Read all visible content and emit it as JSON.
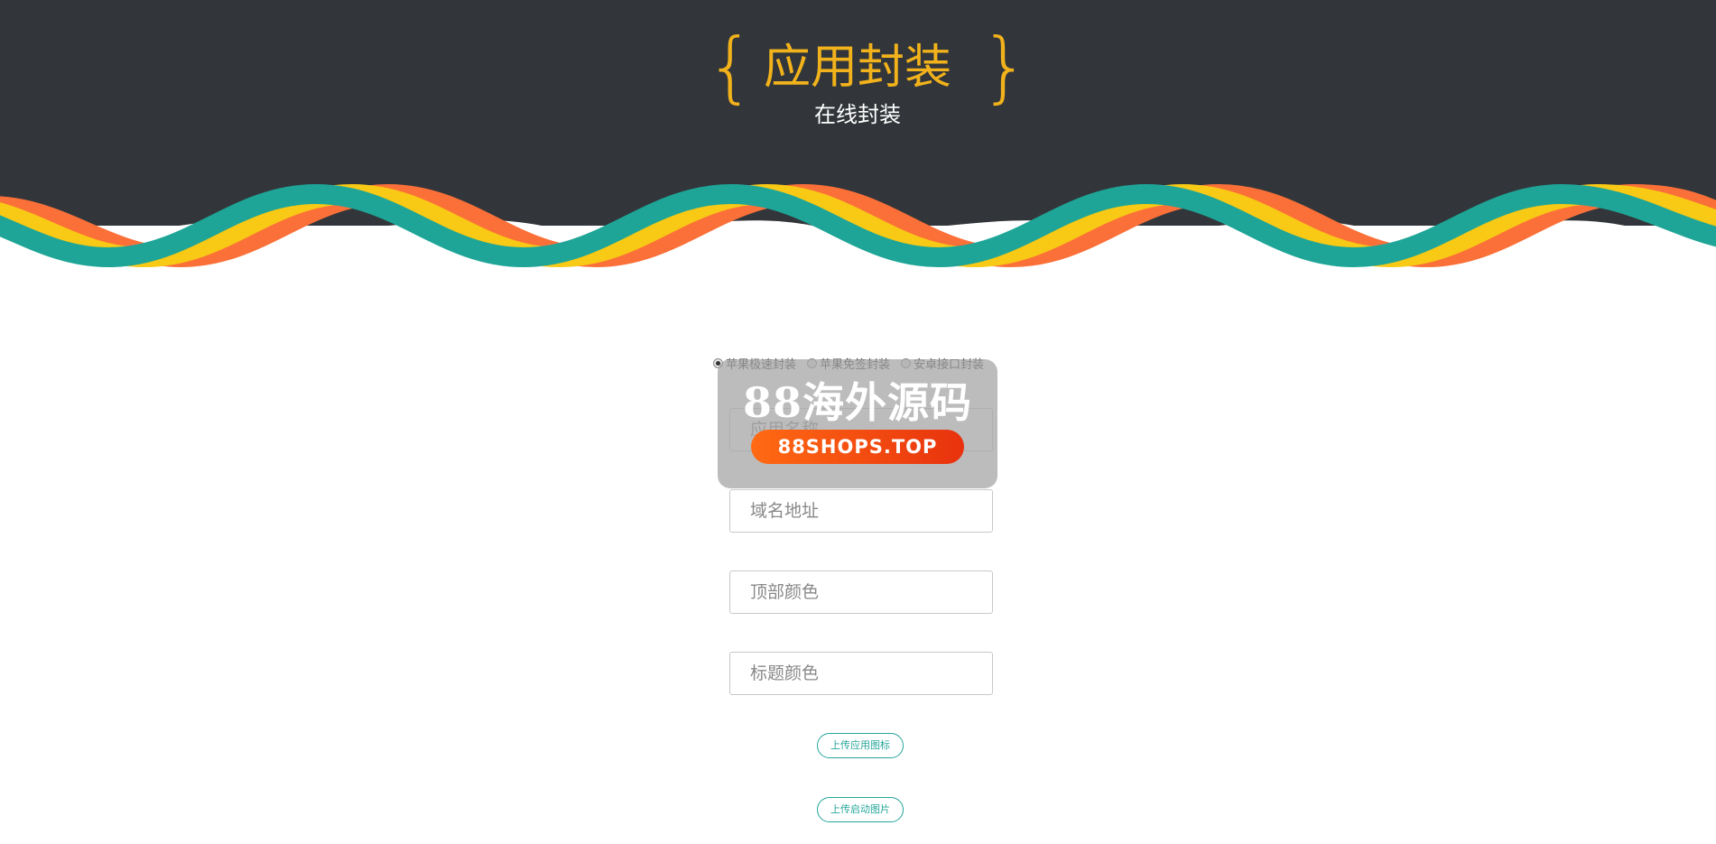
{
  "header": {
    "brace_left": "{",
    "brace_right": "}",
    "title": "应用封装",
    "subtitle": "在线封装"
  },
  "package_types": [
    {
      "label": "苹果极速封装",
      "checked": true
    },
    {
      "label": "苹果免签封装",
      "checked": false
    },
    {
      "label": "安卓接口封装",
      "checked": false
    }
  ],
  "form": {
    "app_name_placeholder": "应用名称",
    "domain_placeholder": "域名地址",
    "top_color_placeholder": "顶部颜色",
    "title_color_placeholder": "标题颜色",
    "upload_icon_label": "上传应用图标",
    "upload_splash_label": "上传启动图片"
  },
  "watermark": {
    "text": "88海外源码",
    "url": "88SHOPS.TOP"
  },
  "colors": {
    "header_bg": "#32363a",
    "accent_yellow": "#f2b21b",
    "wave_teal": "#1ea597",
    "wave_yellow": "#f8c915",
    "wave_orange": "#fb7038",
    "button_teal": "#26a69a"
  }
}
